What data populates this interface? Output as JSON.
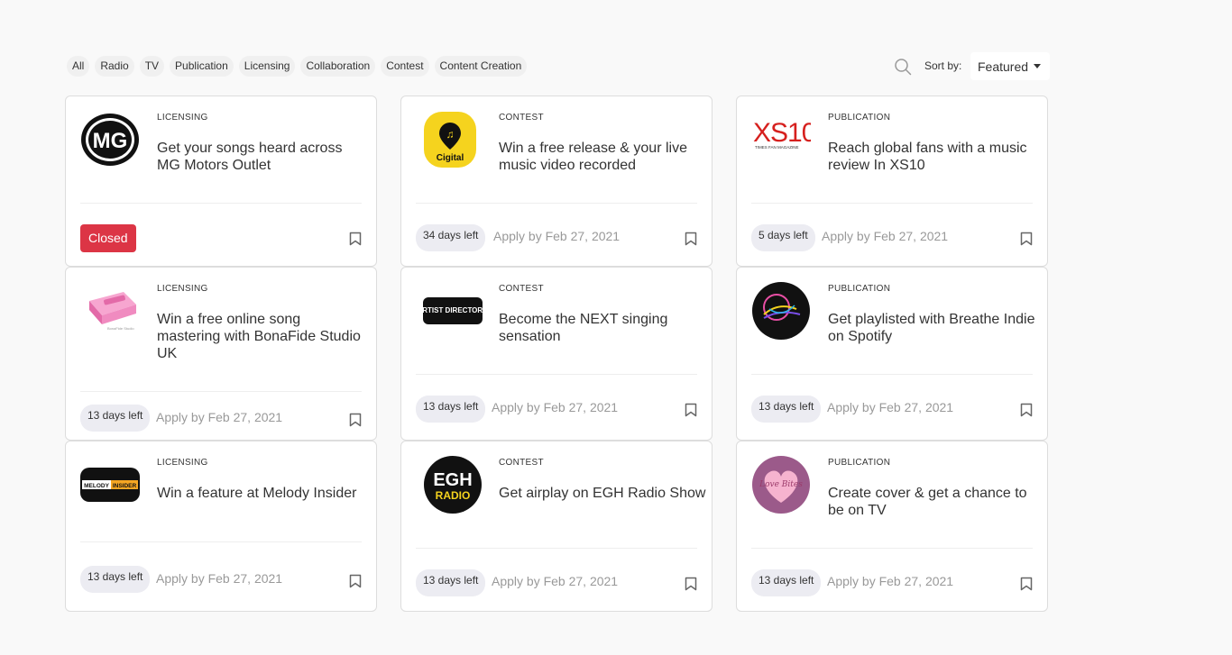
{
  "filters": [
    "All",
    "Radio",
    "TV",
    "Publication",
    "Licensing",
    "Collaboration",
    "Contest",
    "Content Creation"
  ],
  "sort": {
    "label": "Sort by:",
    "value": "Featured"
  },
  "cards": [
    {
      "category": "LICENSING",
      "title": "Get your songs heard across MG Motors Outlet",
      "status": "Closed",
      "logo": "mg-logo"
    },
    {
      "category": "CONTEST",
      "title": "Win a free release & your live music video recorded",
      "days": "34 days left",
      "apply": "Apply by Feb 27, 2021",
      "logo": "cigital-logo",
      "logo_text": "Cigital"
    },
    {
      "category": "PUBLICATION",
      "title": "Reach global fans with a music review In XS10",
      "days": "5 days left",
      "apply": "Apply by Feb 27, 2021",
      "logo": "xs10-logo",
      "logo_text": "XS10",
      "logo_sub": "TIMES FAN MAGAZINE"
    },
    {
      "category": "LICENSING",
      "title": "Win a free online song mastering with BonaFide Studio UK",
      "days": "13 days left",
      "apply": "Apply by Feb 27, 2021",
      "logo": "turntable-logo"
    },
    {
      "category": "CONTEST",
      "title": "Become the NEXT singing sensation",
      "days": "13 days left",
      "apply": "Apply by Feb 27, 2021",
      "logo": "artist-directory-logo",
      "logo_text": "ARTIST DIRECTORY."
    },
    {
      "category": "PUBLICATION",
      "title": "Get playlisted with Breathe Indie on Spotify",
      "days": "13 days left",
      "apply": "Apply by Feb 27, 2021",
      "logo": "breathe-indie-logo"
    },
    {
      "category": "LICENSING",
      "title": "Win a feature at Melody Insider",
      "days": "13 days left",
      "apply": "Apply by Feb 27, 2021",
      "logo": "melody-insider-logo",
      "logo_text": "MELODY",
      "logo_text2": "INSIDER"
    },
    {
      "category": "CONTEST",
      "title": "Get airplay on EGH Radio Show",
      "days": "13 days left",
      "apply": "Apply by Feb 27, 2021",
      "logo": "egh-radio-logo",
      "logo_text": "EGH",
      "logo_text2": "RADIO"
    },
    {
      "category": "PUBLICATION",
      "title": "Create cover & get a chance to be on TV",
      "days": "13 days left",
      "apply": "Apply by Feb 27, 2021",
      "logo": "love-bites-logo",
      "logo_text": "Love Bites"
    }
  ],
  "colors": {
    "closed": "#dc3545",
    "days_bg": "#ececf2",
    "brand_yellow": "#f5d31e"
  }
}
